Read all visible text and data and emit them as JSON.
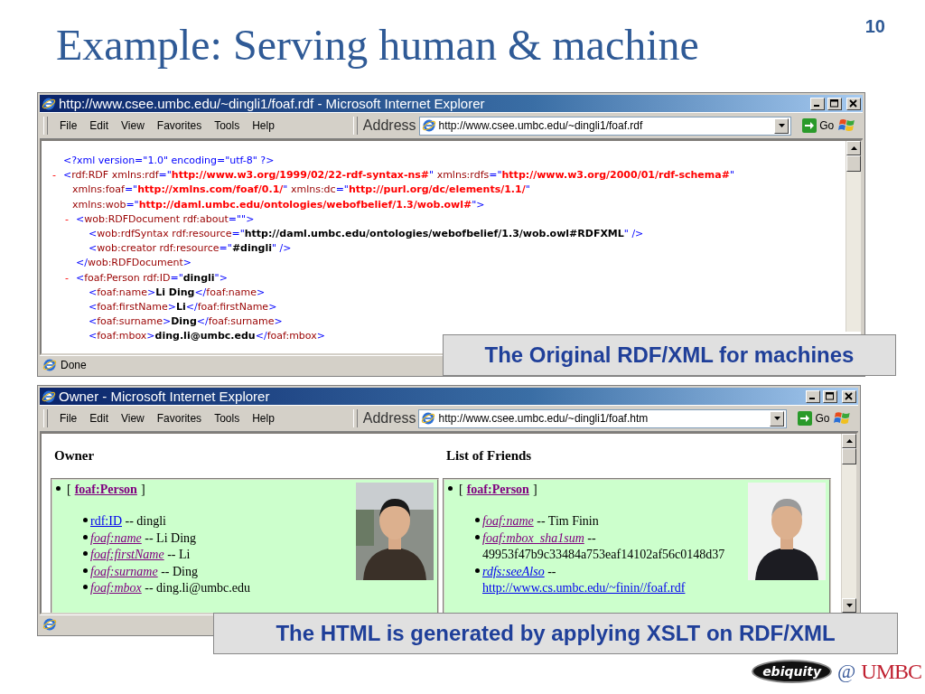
{
  "slide": {
    "title": "Example: Serving human & machine",
    "page_number": "10"
  },
  "windows": [
    {
      "kind": "xml",
      "title": "http://www.csee.umbc.edu/~dingli1/foaf.rdf - Microsoft Internet Explorer",
      "menu": [
        "File",
        "Edit",
        "View",
        "Favorites",
        "Tools",
        "Help"
      ],
      "address_label": "Address",
      "address": "http://www.csee.umbc.edu/~dingli1/foaf.rdf",
      "go_label": "Go",
      "status": "Done",
      "callout": "The Original RDF/XML for machines",
      "xml": [
        {
          "parts": [
            {
              "kind": "mark",
              "text": "<?xml version=\"1.0\" encoding=\"utf-8\" ?>"
            }
          ]
        },
        {
          "toggle": "-",
          "parts": [
            {
              "kind": "mark",
              "text": "<"
            },
            {
              "kind": "name",
              "text": "rdf:RDF xmlns:rdf"
            },
            {
              "kind": "mark",
              "text": "=\""
            },
            {
              "kind": "ns",
              "text": "http://www.w3.org/1999/02/22-rdf-syntax-ns#"
            },
            {
              "kind": "mark",
              "text": "\""
            },
            {
              "kind": "name",
              "text": " xmlns:rdfs"
            },
            {
              "kind": "mark",
              "text": "=\""
            },
            {
              "kind": "ns",
              "text": "http://www.w3.org/2000/01/rdf-schema#"
            },
            {
              "kind": "mark",
              "text": "\""
            },
            {
              "kind": "name",
              "text": " xmlns:foaf"
            },
            {
              "kind": "mark",
              "text": "=\""
            },
            {
              "kind": "ns",
              "text": "http://xmlns.com/foaf/0.1/"
            },
            {
              "kind": "mark",
              "text": "\""
            },
            {
              "kind": "name",
              "text": " xmlns:dc"
            },
            {
              "kind": "mark",
              "text": "=\""
            },
            {
              "kind": "ns",
              "text": "http://purl.org/dc/elements/1.1/"
            },
            {
              "kind": "mark",
              "text": "\""
            },
            {
              "kind": "name",
              "text": " xmlns:wob"
            },
            {
              "kind": "mark",
              "text": "=\""
            },
            {
              "kind": "ns",
              "text": "http://daml.umbc.edu/ontologies/webofbelief/1.3/wob.owl#"
            },
            {
              "kind": "mark",
              "text": "\">"
            }
          ],
          "children": [
            {
              "toggle": "-",
              "parts": [
                {
                  "kind": "mark",
                  "text": "<"
                },
                {
                  "kind": "name",
                  "text": "wob:RDFDocument rdf:about"
                },
                {
                  "kind": "mark",
                  "text": "=\"\">"
                }
              ],
              "children": [
                {
                  "parts": [
                    {
                      "kind": "mark",
                      "text": "<"
                    },
                    {
                      "kind": "name",
                      "text": "wob:rdfSyntax rdf:resource"
                    },
                    {
                      "kind": "mark",
                      "text": "=\""
                    },
                    {
                      "kind": "value",
                      "text": "http://daml.umbc.edu/ontologies/webofbelief/1.3/wob.owl#RDFXML"
                    },
                    {
                      "kind": "mark",
                      "text": "\" />"
                    }
                  ]
                },
                {
                  "parts": [
                    {
                      "kind": "mark",
                      "text": "<"
                    },
                    {
                      "kind": "name",
                      "text": "wob:creator rdf:resource"
                    },
                    {
                      "kind": "mark",
                      "text": "=\""
                    },
                    {
                      "kind": "value",
                      "text": "#dingli"
                    },
                    {
                      "kind": "mark",
                      "text": "\" />"
                    }
                  ]
                }
              ],
              "closing": [
                {
                  "kind": "mark",
                  "text": "</"
                },
                {
                  "kind": "name",
                  "text": "wob:RDFDocument"
                },
                {
                  "kind": "mark",
                  "text": ">"
                }
              ]
            },
            {
              "toggle": "-",
              "parts": [
                {
                  "kind": "mark",
                  "text": "<"
                },
                {
                  "kind": "name",
                  "text": "foaf:Person rdf:ID"
                },
                {
                  "kind": "mark",
                  "text": "=\""
                },
                {
                  "kind": "value",
                  "text": "dingli"
                },
                {
                  "kind": "mark",
                  "text": "\">"
                }
              ],
              "children": [
                {
                  "parts": [
                    {
                      "kind": "mark",
                      "text": "<"
                    },
                    {
                      "kind": "name",
                      "text": "foaf:name"
                    },
                    {
                      "kind": "mark",
                      "text": ">"
                    },
                    {
                      "kind": "value",
                      "text": "Li Ding"
                    },
                    {
                      "kind": "mark",
                      "text": "</"
                    },
                    {
                      "kind": "name",
                      "text": "foaf:name"
                    },
                    {
                      "kind": "mark",
                      "text": ">"
                    }
                  ]
                },
                {
                  "parts": [
                    {
                      "kind": "mark",
                      "text": "<"
                    },
                    {
                      "kind": "name",
                      "text": "foaf:firstName"
                    },
                    {
                      "kind": "mark",
                      "text": ">"
                    },
                    {
                      "kind": "value",
                      "text": "Li"
                    },
                    {
                      "kind": "mark",
                      "text": "</"
                    },
                    {
                      "kind": "name",
                      "text": "foaf:firstName"
                    },
                    {
                      "kind": "mark",
                      "text": ">"
                    }
                  ]
                },
                {
                  "parts": [
                    {
                      "kind": "mark",
                      "text": "<"
                    },
                    {
                      "kind": "name",
                      "text": "foaf:surname"
                    },
                    {
                      "kind": "mark",
                      "text": ">"
                    },
                    {
                      "kind": "value",
                      "text": "Ding"
                    },
                    {
                      "kind": "mark",
                      "text": "</"
                    },
                    {
                      "kind": "name",
                      "text": "foaf:surname"
                    },
                    {
                      "kind": "mark",
                      "text": ">"
                    }
                  ]
                },
                {
                  "parts": [
                    {
                      "kind": "mark",
                      "text": "<"
                    },
                    {
                      "kind": "name",
                      "text": "foaf:mbox"
                    },
                    {
                      "kind": "mark",
                      "text": ">"
                    },
                    {
                      "kind": "value",
                      "text": "ding.li@umbc.edu"
                    },
                    {
                      "kind": "mark",
                      "text": "</"
                    },
                    {
                      "kind": "name",
                      "text": "foaf:mbox"
                    },
                    {
                      "kind": "mark",
                      "text": ">"
                    }
                  ]
                }
              ]
            }
          ]
        }
      ]
    },
    {
      "kind": "html",
      "title": "Owner - Microsoft Internet Explorer",
      "menu": [
        "File",
        "Edit",
        "View",
        "Favorites",
        "Tools",
        "Help"
      ],
      "address_label": "Address",
      "address": "http://www.csee.umbc.edu/~dingli1/foaf.htm",
      "go_label": "Go",
      "callout": "The HTML is generated by applying XSLT on RDF/XML",
      "columns": [
        {
          "heading": "Owner",
          "panel": {
            "open": "[",
            "type_link": "foaf:Person",
            "close": "]",
            "items": [
              {
                "property": "rdf:ID",
                "visited": false,
                "italic": false,
                "value": "-- dingli"
              },
              {
                "property": "foaf:name",
                "visited": true,
                "italic": true,
                "value": "-- Li Ding"
              },
              {
                "property": "foaf:firstName",
                "visited": true,
                "italic": true,
                "value": "-- Li"
              },
              {
                "property": "foaf:surname",
                "visited": true,
                "italic": true,
                "value": "-- Ding"
              },
              {
                "property": "foaf:mbox",
                "visited": true,
                "italic": true,
                "value": "-- ding.li@umbc.edu"
              }
            ]
          }
        },
        {
          "heading": "List of Friends",
          "panel": {
            "open": "[",
            "type_link": "foaf:Person",
            "close": "]",
            "items": [
              {
                "property": "foaf:name",
                "visited": true,
                "italic": true,
                "value": "-- Tim Finin"
              },
              {
                "property": "foaf:mbox_sha1sum",
                "visited": true,
                "italic": true,
                "value": "--",
                "value_line": "49953f47b9c33484a753eaf14102af56c0148d37"
              },
              {
                "property": "rdfs:seeAlso",
                "visited": false,
                "italic": true,
                "value": "--",
                "value_link": "http://www.cs.umbc.edu/~finin//foaf.rdf"
              }
            ]
          }
        }
      ]
    }
  ],
  "footer": {
    "group_logo": "ebiquity",
    "at": "@",
    "university": "UMBC"
  }
}
